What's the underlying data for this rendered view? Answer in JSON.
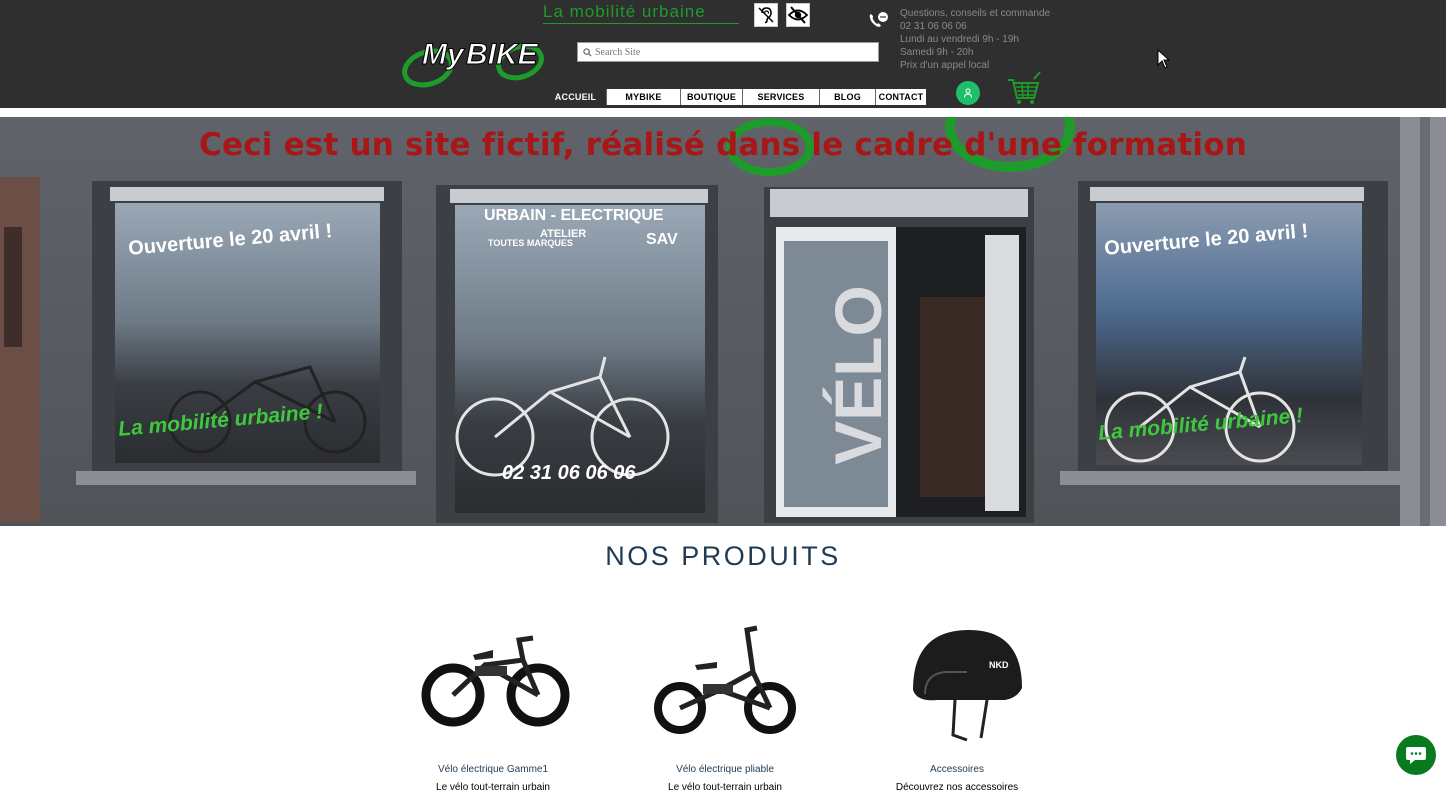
{
  "header": {
    "tagline": "La mobilité urbaine",
    "logo_text": "MyBIKE",
    "search": {
      "placeholder": "Search Site"
    },
    "contact": {
      "line1": "Questions, conseils et commande",
      "line2": "02 31 06 06 06",
      "line3": "Lundi au vendredi 9h - 19h",
      "line4": "Samedi 9h - 20h",
      "line5": "Prix d'un appel local"
    },
    "icons": {
      "deaf": "ear-slash-icon",
      "blind": "eye-slash-icon",
      "phone": "phone-chat-icon",
      "user": "user-icon",
      "cart": "shopping-cart-icon"
    },
    "colors": {
      "brand_green": "#1e9c2b",
      "header_bg": "#2f2f2f",
      "user_green": "#1fbf6a"
    }
  },
  "nav": {
    "items": [
      {
        "label": "ACCUEIL",
        "active": true
      },
      {
        "label": "MYBIKE",
        "active": false
      },
      {
        "label": "BOUTIQUE",
        "active": false
      },
      {
        "label": "SERVICES",
        "active": false
      },
      {
        "label": "BLOG",
        "active": false
      },
      {
        "label": "CONTACT",
        "active": false
      }
    ]
  },
  "hero": {
    "banner": "Ceci est un site fictif, réalisé dans le cadre d'une formation",
    "left_window_title": "Ouverture le 20 avril !",
    "left_window_slogan": "La mobilité urbaine !",
    "center_window_title": "URBAIN - ELECTRIQUE",
    "center_window_sub1": "ATELIER",
    "center_window_sub2": "TOUTES MARQUES",
    "center_window_sav": "SAV",
    "center_window_phone": "02 31 06 06 06",
    "door_text": "VÉLO",
    "right_window_title": "Ouverture le 20 avril !",
    "right_window_slogan": "La mobilité urbaine !"
  },
  "products": {
    "title": "NOS PRODUITS",
    "items": [
      {
        "name": "Vélo électrique Gamme1",
        "desc": "Le vélo tout-terrain urbain",
        "image": "fat-bike-image"
      },
      {
        "name": "Vélo électrique pliable",
        "desc": "Le vélo tout-terrain urbain",
        "image": "folding-bike-image"
      },
      {
        "name": "Accessoires",
        "desc": "Découvrez nos accessoires",
        "image": "helmet-image"
      }
    ]
  },
  "chat": {
    "icon": "chat-bubble-icon"
  }
}
